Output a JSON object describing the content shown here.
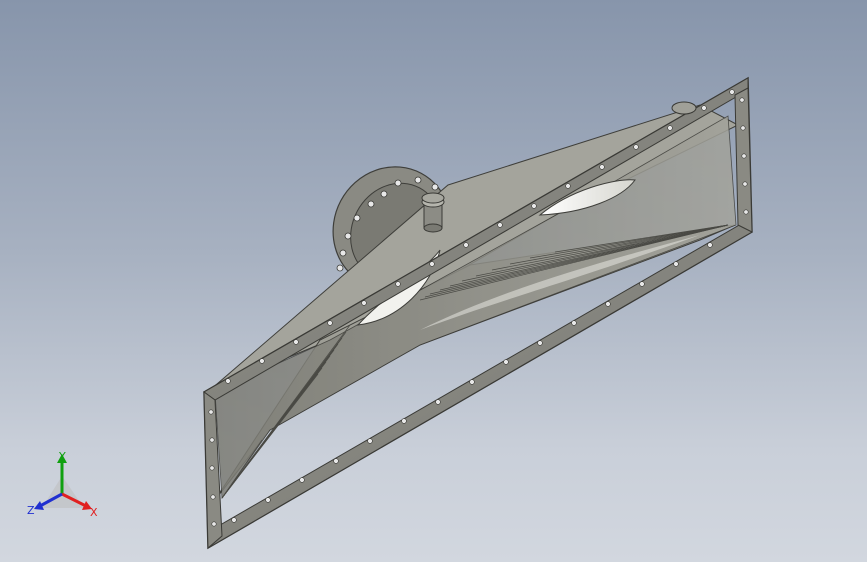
{
  "viewport": {
    "background_top": "#8795ab",
    "background_bottom": "#d2d7df",
    "model_fill": "#8e8e87",
    "model_dark": "#5a5a55",
    "model_light": "#b9b9b1"
  },
  "triad": {
    "x_label": "X",
    "y_label": "Y",
    "z_label": "Z",
    "x_color": "#e02020",
    "y_color": "#10a010",
    "z_color": "#2030d0"
  }
}
